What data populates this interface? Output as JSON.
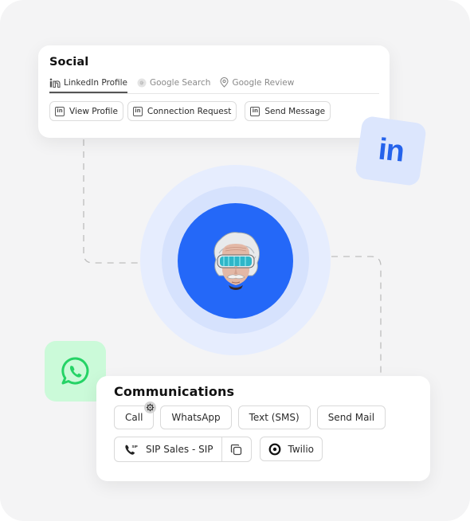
{
  "social": {
    "title": "Social",
    "tabs": [
      {
        "label": "LinkedIn Profile",
        "icon": "linkedin-icon",
        "active": true
      },
      {
        "label": "Google Search",
        "icon": "google-icon",
        "active": false
      },
      {
        "label": "Google Review",
        "icon": "location-pin-icon",
        "active": false
      }
    ],
    "actions": [
      {
        "label": "View Profile",
        "icon": "linkedin-icon"
      },
      {
        "label": "Connection Request",
        "icon": "linkedin-icon"
      },
      {
        "label": "Send Message",
        "icon": "linkedin-icon"
      }
    ]
  },
  "linkedin_tile": {
    "text": "in",
    "icon": "linkedin-logo-icon"
  },
  "avatar": {
    "icon": "avatar-einstein-goggles"
  },
  "whatsapp_tile": {
    "icon": "whatsapp-icon"
  },
  "communications": {
    "title": "Communications",
    "channels": [
      {
        "label": "Call",
        "badge_icon": "gear-icon"
      },
      {
        "label": "WhatsApp"
      },
      {
        "label": "Text (SMS)"
      },
      {
        "label": "Send Mail"
      }
    ],
    "sip": {
      "label": "SIP Sales - SIP",
      "icon": "sip-phone-icon",
      "copy_icon": "copy-icon"
    },
    "provider": {
      "label": "Twilio",
      "icon": "twilio-icon"
    }
  },
  "colors": {
    "accent_blue": "#2468f8",
    "linkedin_blue": "#2563eb",
    "whatsapp_green": "#25d366",
    "background": "#f4f4f5"
  }
}
